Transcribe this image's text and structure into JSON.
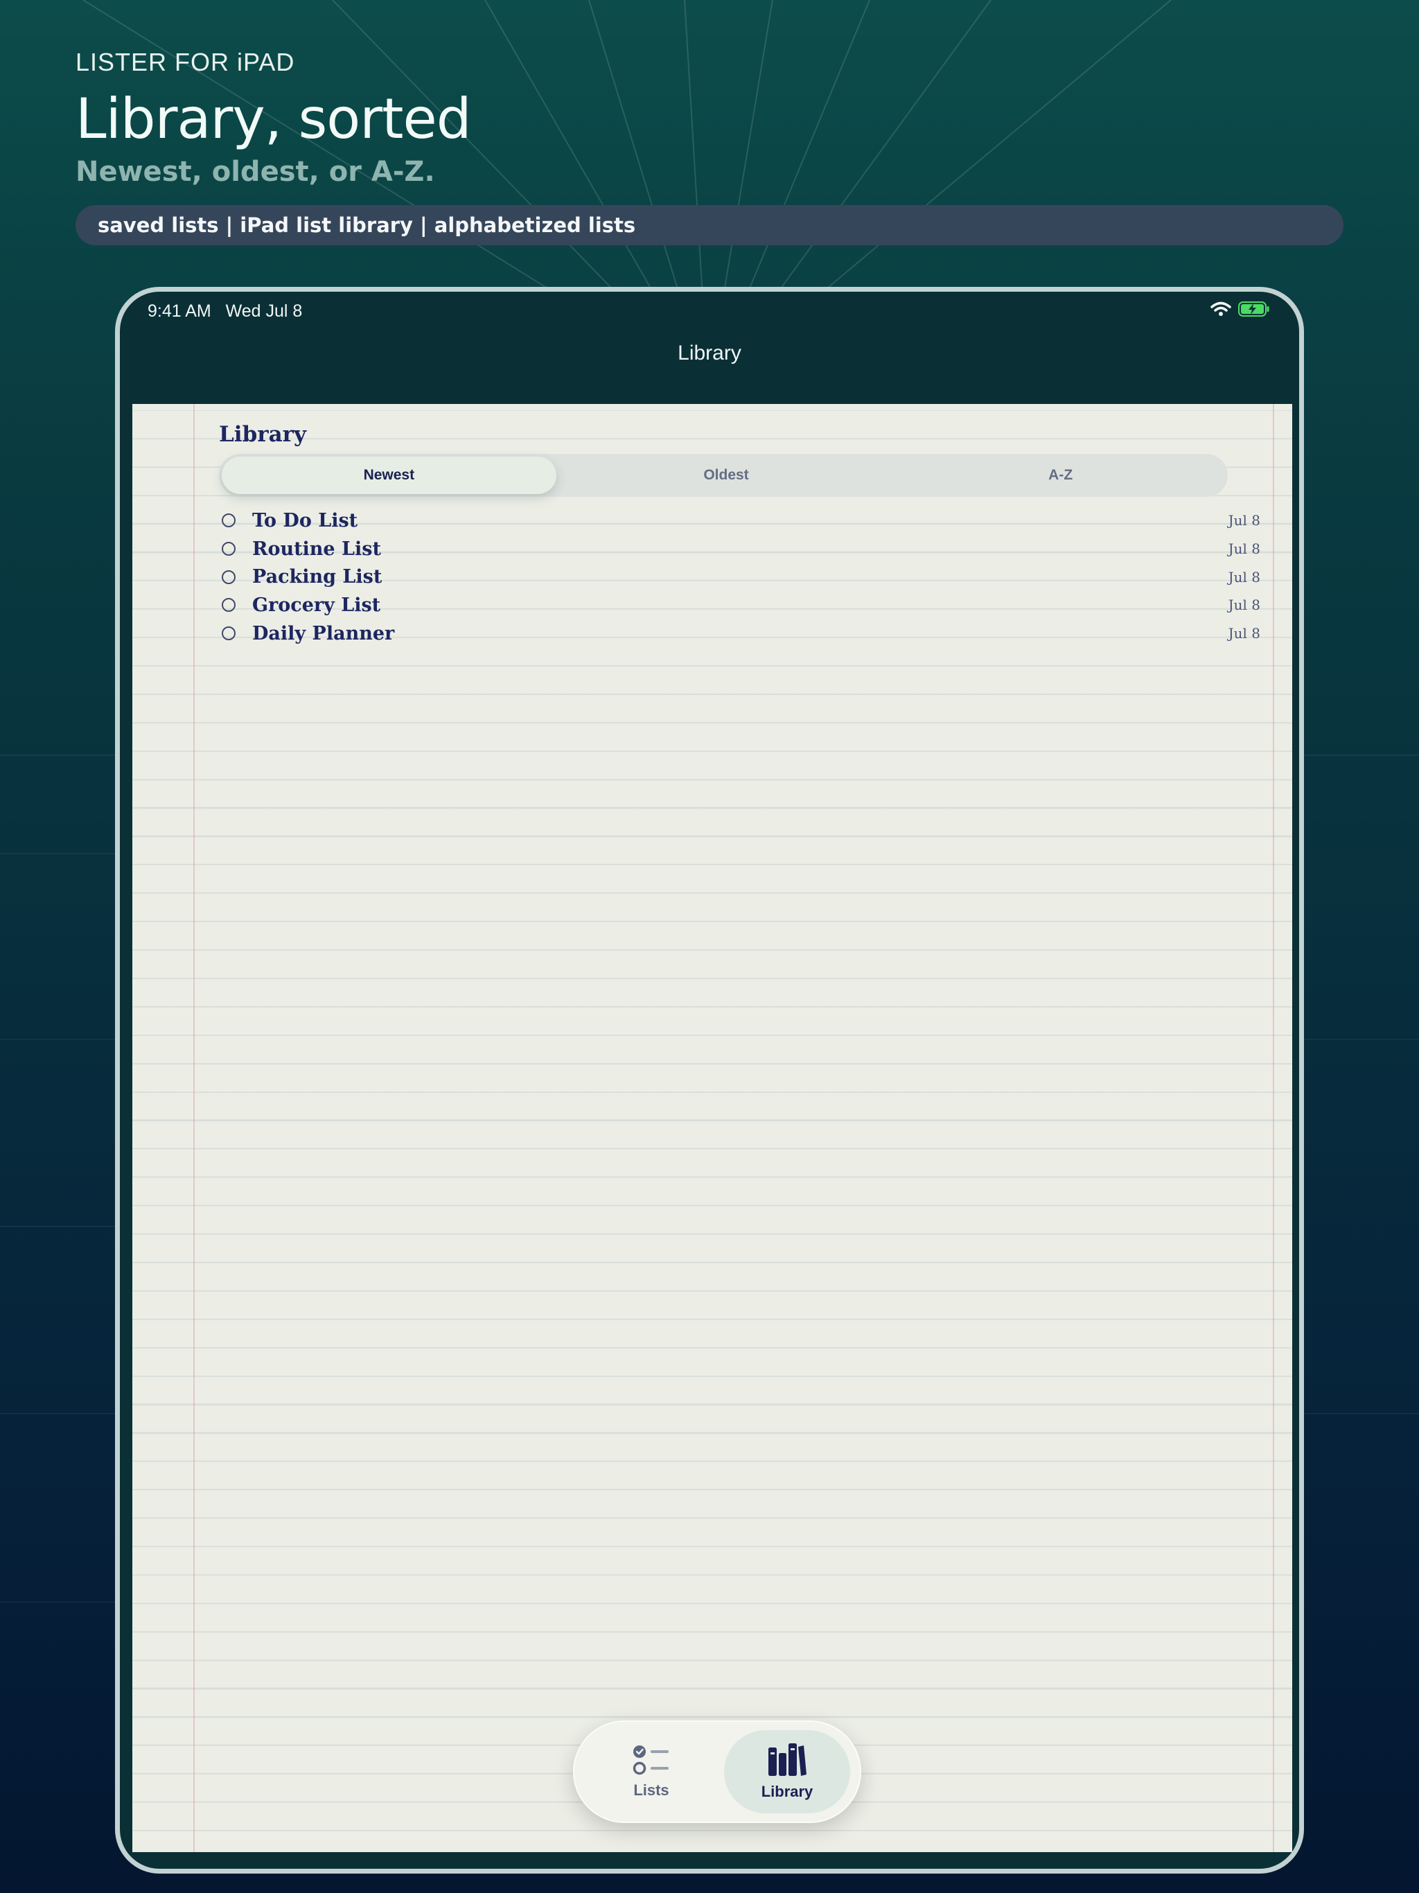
{
  "marketing": {
    "eyebrow": "LISTER FOR iPAD",
    "title": "Library, sorted",
    "subtitle": "Newest, oldest, or A-Z.",
    "keywords": "saved lists | iPad list library | alphabetized lists"
  },
  "status_bar": {
    "time": "9:41 AM",
    "date": "Wed Jul 8",
    "icons": [
      "wifi-icon",
      "battery-charging-icon"
    ]
  },
  "nav": {
    "title": "Library"
  },
  "library": {
    "heading": "Library",
    "sort_options": [
      "Newest",
      "Oldest",
      "A-Z"
    ],
    "selected_sort": "Newest",
    "items": [
      {
        "name": "To Do List",
        "date": "Jul 8"
      },
      {
        "name": "Routine List",
        "date": "Jul 8"
      },
      {
        "name": "Packing List",
        "date": "Jul 8"
      },
      {
        "name": "Grocery List",
        "date": "Jul 8"
      },
      {
        "name": "Daily Planner",
        "date": "Jul 8"
      }
    ]
  },
  "tab_bar": {
    "tabs": [
      {
        "label": "Lists",
        "icon": "checklist-icon",
        "selected": false
      },
      {
        "label": "Library",
        "icon": "books-icon",
        "selected": true
      }
    ]
  },
  "colors": {
    "background_top": "#0c4c4a",
    "background_bottom": "#041630",
    "ink": "#1d2660",
    "paper": "#eceee6",
    "battery_green": "#4cd964"
  }
}
